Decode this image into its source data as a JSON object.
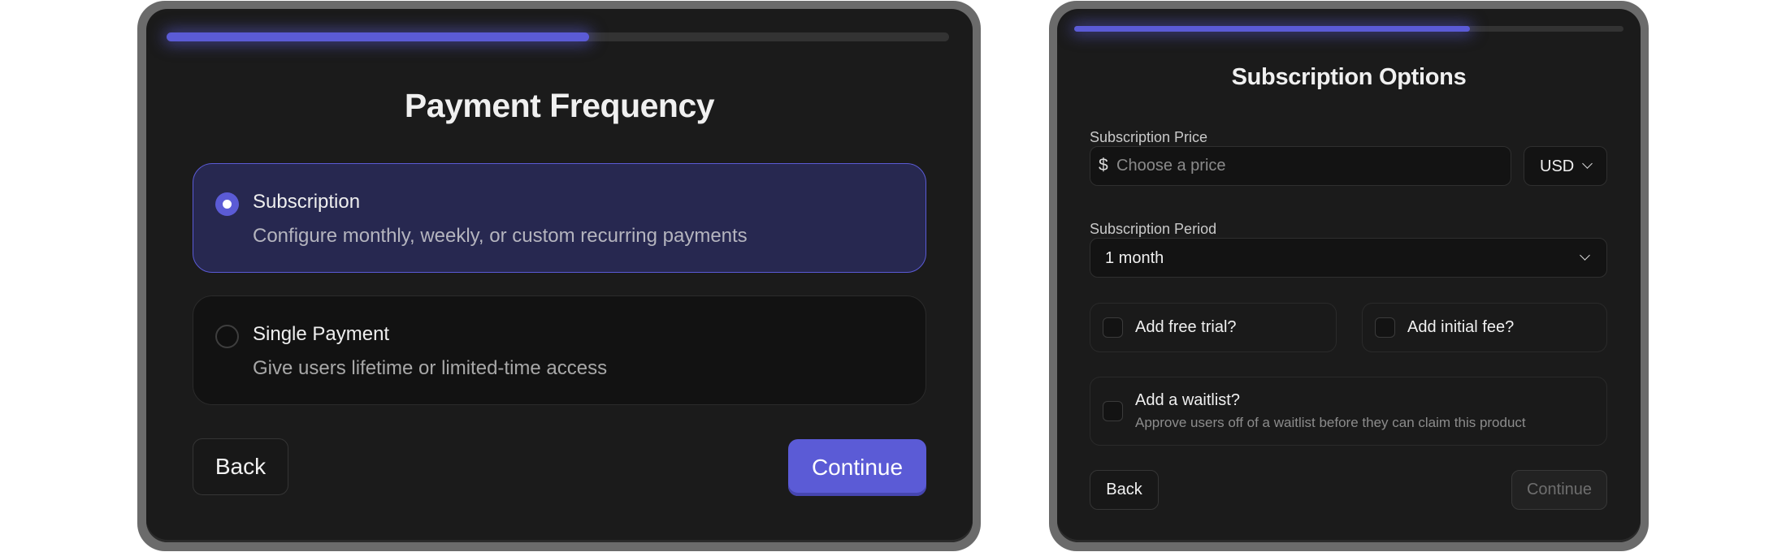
{
  "colors": {
    "accent": "#5b5bd6",
    "panel_bg": "#1b1b1b",
    "frame": "#6b6b6b",
    "selected_card_bg": "#272850"
  },
  "payment_frequency": {
    "progress": 0.54,
    "title": "Payment Frequency",
    "options": [
      {
        "title": "Subscription",
        "description": "Configure monthly, weekly, or custom recurring payments",
        "selected": true
      },
      {
        "title": "Single Payment",
        "description": "Give users lifetime or limited-time access",
        "selected": false
      }
    ],
    "back_label": "Back",
    "continue_label": "Continue"
  },
  "subscription_options": {
    "progress": 0.72,
    "title": "Subscription Options",
    "price": {
      "label": "Subscription Price",
      "currency_symbol": "$",
      "value": "",
      "placeholder": "Choose a price",
      "currency": "USD",
      "currency_icon": "chevron-down-icon"
    },
    "period": {
      "label": "Subscription Period",
      "value": "1 month",
      "icon": "chevron-down-icon"
    },
    "free_trial": {
      "label": "Add free trial?",
      "checked": false
    },
    "initial_fee": {
      "label": "Add initial fee?",
      "checked": false
    },
    "waitlist": {
      "label": "Add a waitlist?",
      "description": "Approve users off of a waitlist before they can claim this product",
      "checked": false
    },
    "back_label": "Back",
    "continue_label": "Continue",
    "continue_disabled": true
  }
}
